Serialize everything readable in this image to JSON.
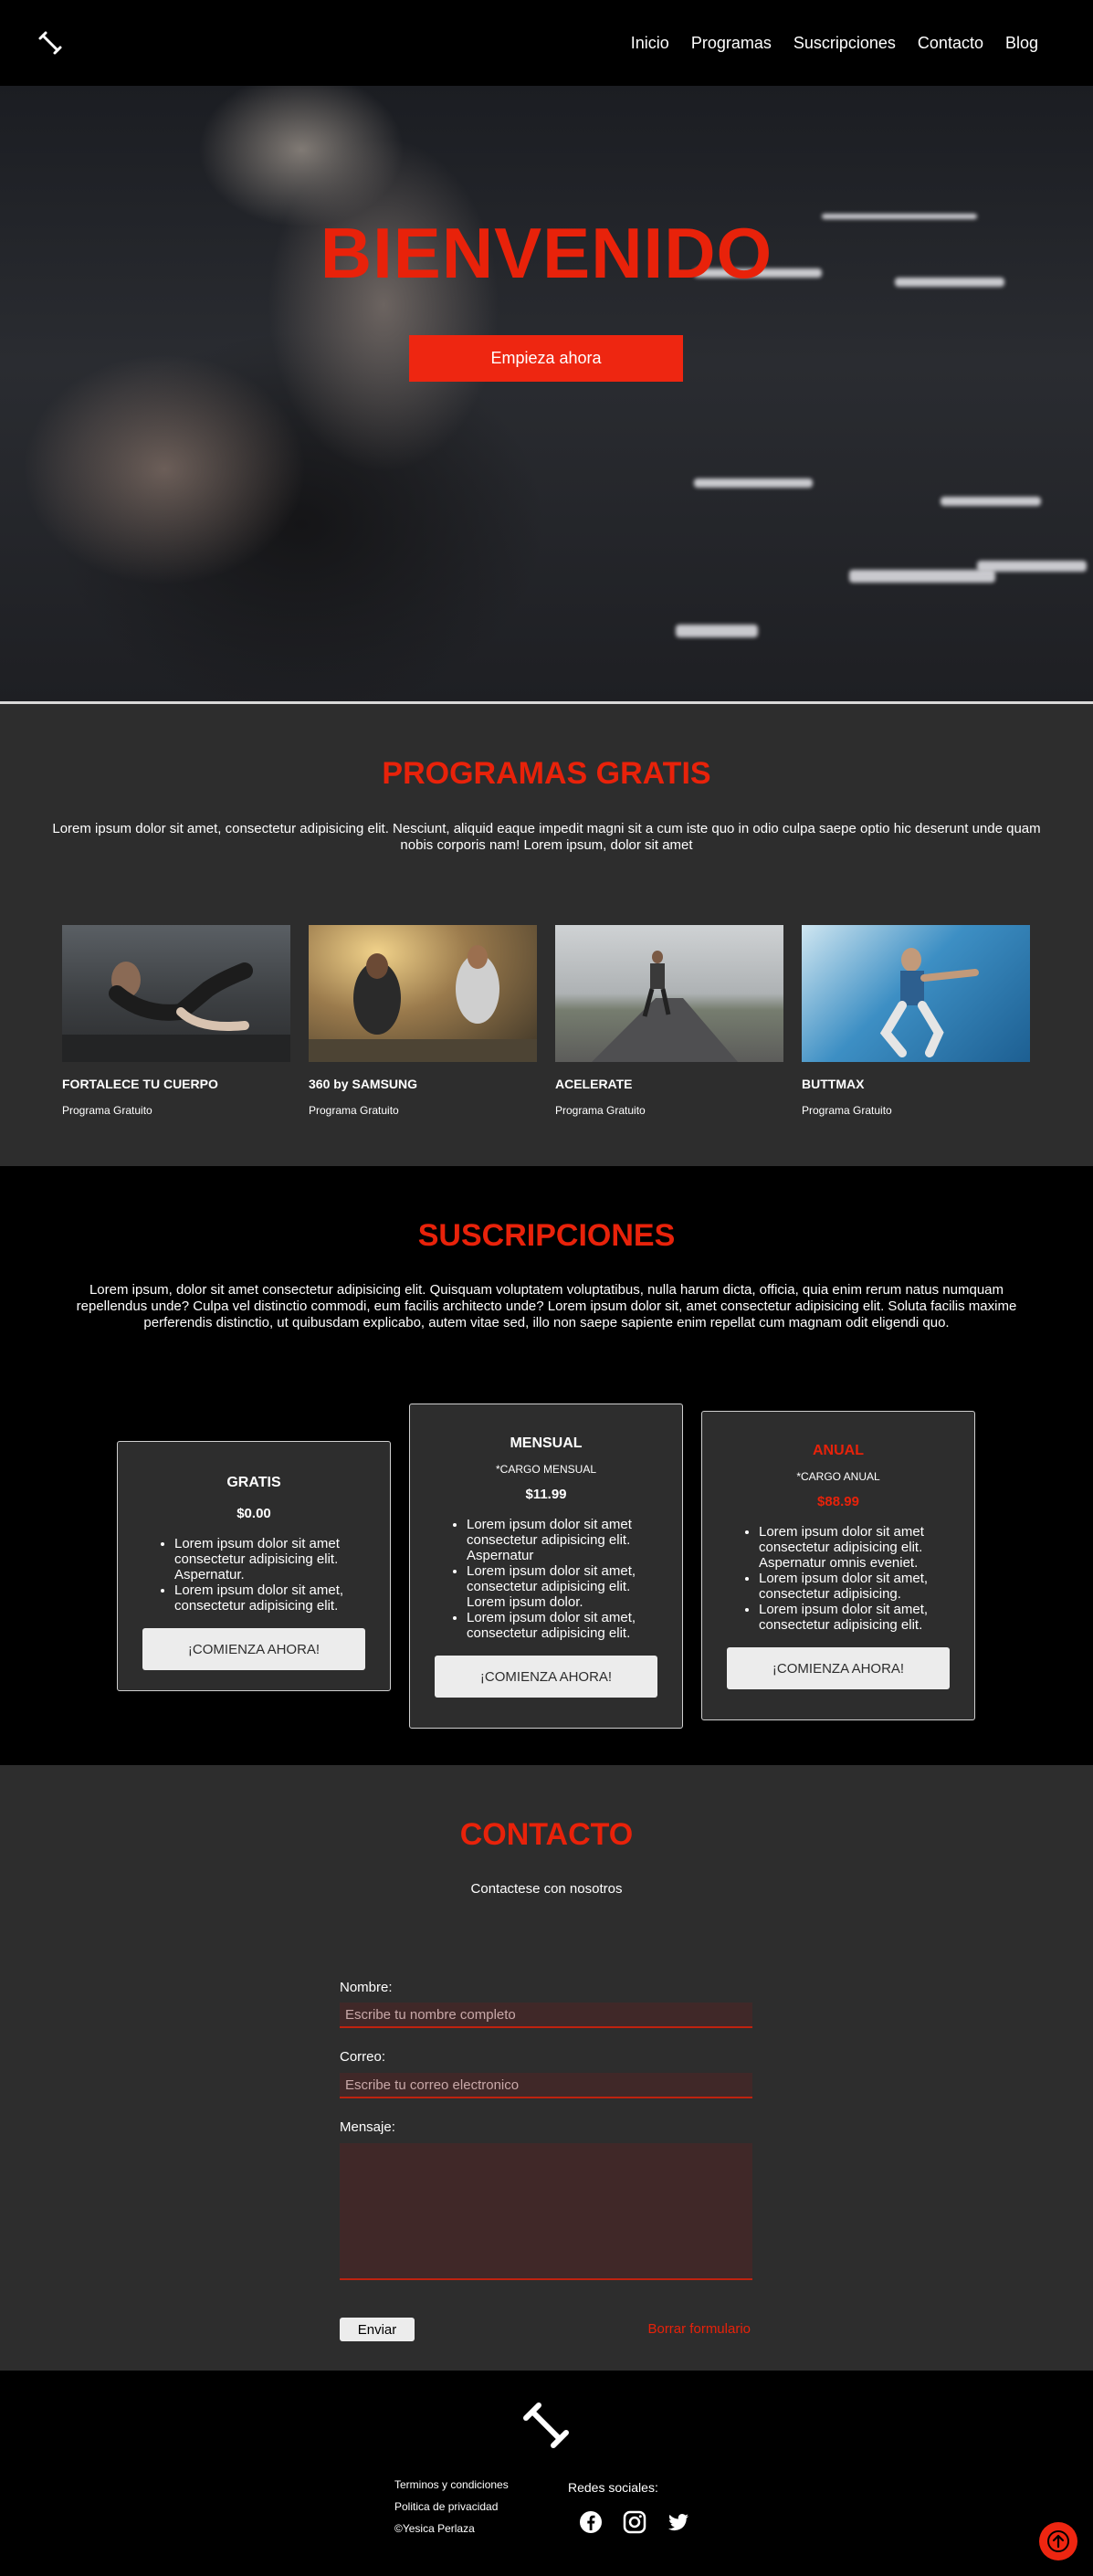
{
  "header": {
    "logo_icon": "dumbbell-icon",
    "nav": [
      "Inicio",
      "Programas",
      "Suscripciones",
      "Contacto",
      "Blog"
    ]
  },
  "hero": {
    "title": "BIENVENIDO",
    "cta": "Empieza ahora"
  },
  "programs": {
    "title": "PROGRAMAS GRATIS",
    "description": "Lorem ipsum dolor sit amet, consectetur adipisicing elit. Nesciunt, aliquid eaque impedit magni sit a cum iste quo in odio culpa saepe optio hic deserunt unde quam nobis corporis nam! Lorem ipsum, dolor sit amet",
    "items": [
      {
        "name": "FORTALECE TU CUERPO",
        "subtitle": "Programa Gratuito"
      },
      {
        "name": "360 by SAMSUNG",
        "subtitle": "Programa Gratuito"
      },
      {
        "name": "ACELERATE",
        "subtitle": "Programa Gratuito"
      },
      {
        "name": "BUTTMAX",
        "subtitle": "Programa Gratuito"
      }
    ]
  },
  "subscriptions": {
    "title": "SUSCRIPCIONES",
    "description": "Lorem ipsum, dolor sit amet consectetur adipisicing elit. Quisquam voluptatem voluptatibus, nulla harum dicta, officia, quia enim rerum natus numquam repellendus unde? Culpa vel distinctio commodi, eum facilis architecto unde? Lorem ipsum dolor sit, amet consectetur adipisicing elit. Soluta facilis maxime perferendis distinctio, ut quibusdam explicabo, autem vitae sed, illo non saepe sapiente enim repellat cum magnam odit eligendi quo.",
    "plans": [
      {
        "name": "GRATIS",
        "price": "$0.00",
        "features": [
          "Lorem ipsum dolor sit amet consectetur adipisicing elit. Aspernatur.",
          "Lorem ipsum dolor sit amet, consectetur adipisicing elit."
        ],
        "button": "¡COMIENZA AHORA!"
      },
      {
        "name": "MENSUAL",
        "note": "*CARGO MENSUAL",
        "price": "$11.99",
        "features": [
          "Lorem ipsum dolor sit amet consectetur adipisicing elit. Aspernatur",
          "Lorem ipsum dolor sit amet, consectetur adipisicing elit. Lorem ipsum dolor.",
          "Lorem ipsum dolor sit amet, consectetur adipisicing elit."
        ],
        "button": "¡COMIENZA AHORA!"
      },
      {
        "name": "ANUAL",
        "note": "*CARGO ANUAL",
        "price": "$88.99",
        "features": [
          "Lorem ipsum dolor sit amet consectetur adipisicing elit. Aspernatur omnis eveniet.",
          "Lorem ipsum dolor sit amet, consectetur adipisicing.",
          "Lorem ipsum dolor sit amet, consectetur adipisicing elit."
        ],
        "button": "¡COMIENZA AHORA!"
      }
    ]
  },
  "contact": {
    "title": "CONTACTO",
    "subtitle": "Contactese con nosotros",
    "name_label": "Nombre:",
    "name_placeholder": "Escribe tu nombre completo",
    "email_label": "Correo:",
    "email_placeholder": "Escribe tu correo electronico",
    "message_label": "Mensaje:",
    "send": "Enviar",
    "clear": "Borrar formulario"
  },
  "footer": {
    "links": [
      "Terminos y condiciones",
      "Politica de privacidad",
      "©Yesica Perlaza"
    ],
    "social_title": "Redes sociales:",
    "social_icons": [
      "facebook-icon",
      "instagram-icon",
      "twitter-icon"
    ]
  },
  "colors": {
    "accent": "#e8220a",
    "dark": "#2d2d2d",
    "black": "#000000"
  }
}
